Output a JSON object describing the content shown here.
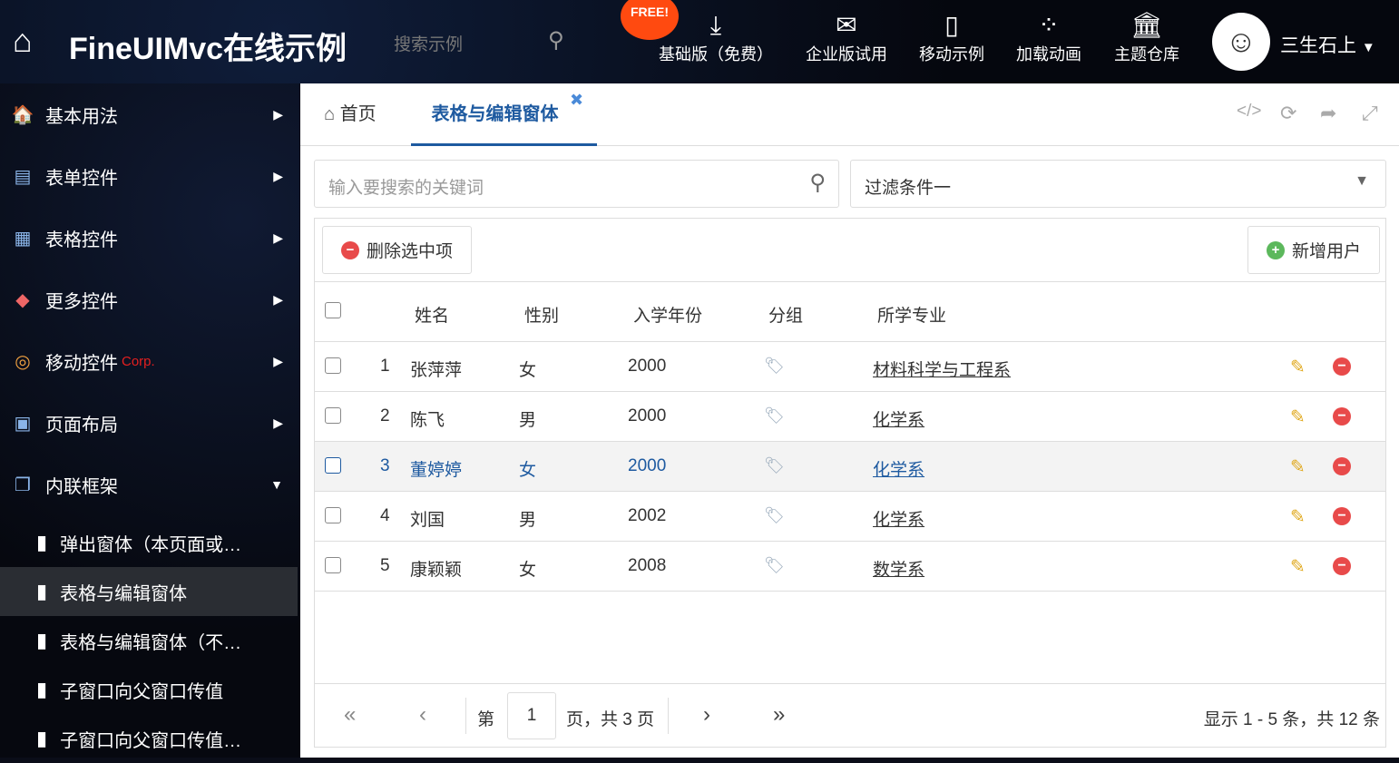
{
  "header": {
    "title": "FineUIMvc在线示例",
    "search_placeholder": "搜索示例",
    "free_badge": "FREE!",
    "nav": [
      {
        "label": "基础版（免费）",
        "icon": "download-icon"
      },
      {
        "label": "企业版试用",
        "icon": "envelope-icon"
      },
      {
        "label": "移动示例",
        "icon": "mobile-icon"
      },
      {
        "label": "加载动画",
        "icon": "spinner-icon"
      },
      {
        "label": "主题仓库",
        "icon": "bank-icon"
      }
    ],
    "user": "三生石上"
  },
  "sidebar": {
    "items": [
      {
        "label": "基本用法"
      },
      {
        "label": "表单控件"
      },
      {
        "label": "表格控件"
      },
      {
        "label": "更多控件"
      },
      {
        "label": "移动控件",
        "badge": "Corp."
      },
      {
        "label": "页面布局"
      },
      {
        "label": "内联框架"
      }
    ],
    "sub_items": [
      {
        "label": "弹出窗体（本页面或…"
      },
      {
        "label": "表格与编辑窗体"
      },
      {
        "label": "表格与编辑窗体（不…"
      },
      {
        "label": "子窗口向父窗口传值"
      },
      {
        "label": "子窗口向父窗口传值…"
      }
    ]
  },
  "tabs": [
    {
      "label": "首页"
    },
    {
      "label": "表格与编辑窗体"
    }
  ],
  "search": {
    "placeholder": "输入要搜索的关键词"
  },
  "filter": {
    "value": "过滤条件一"
  },
  "toolbar": {
    "delete": "删除选中项",
    "add": "新增用户"
  },
  "columns": [
    "姓名",
    "性别",
    "入学年份",
    "分组",
    "所学专业"
  ],
  "rows": [
    {
      "no": "1",
      "name": "张萍萍",
      "gender": "女",
      "year": "2000",
      "major": "材料科学与工程系"
    },
    {
      "no": "2",
      "name": "陈飞",
      "gender": "男",
      "year": "2000",
      "major": "化学系"
    },
    {
      "no": "3",
      "name": "董婷婷",
      "gender": "女",
      "year": "2000",
      "major": "化学系"
    },
    {
      "no": "4",
      "name": "刘国",
      "gender": "男",
      "year": "2002",
      "major": "化学系"
    },
    {
      "no": "5",
      "name": "康颖颖",
      "gender": "女",
      "year": "2008",
      "major": "数学系"
    }
  ],
  "pager": {
    "page_prefix": "第",
    "page": "1",
    "page_suffix": "页，共 3 页",
    "summary": "显示 1 - 5 条，共 12 条"
  }
}
